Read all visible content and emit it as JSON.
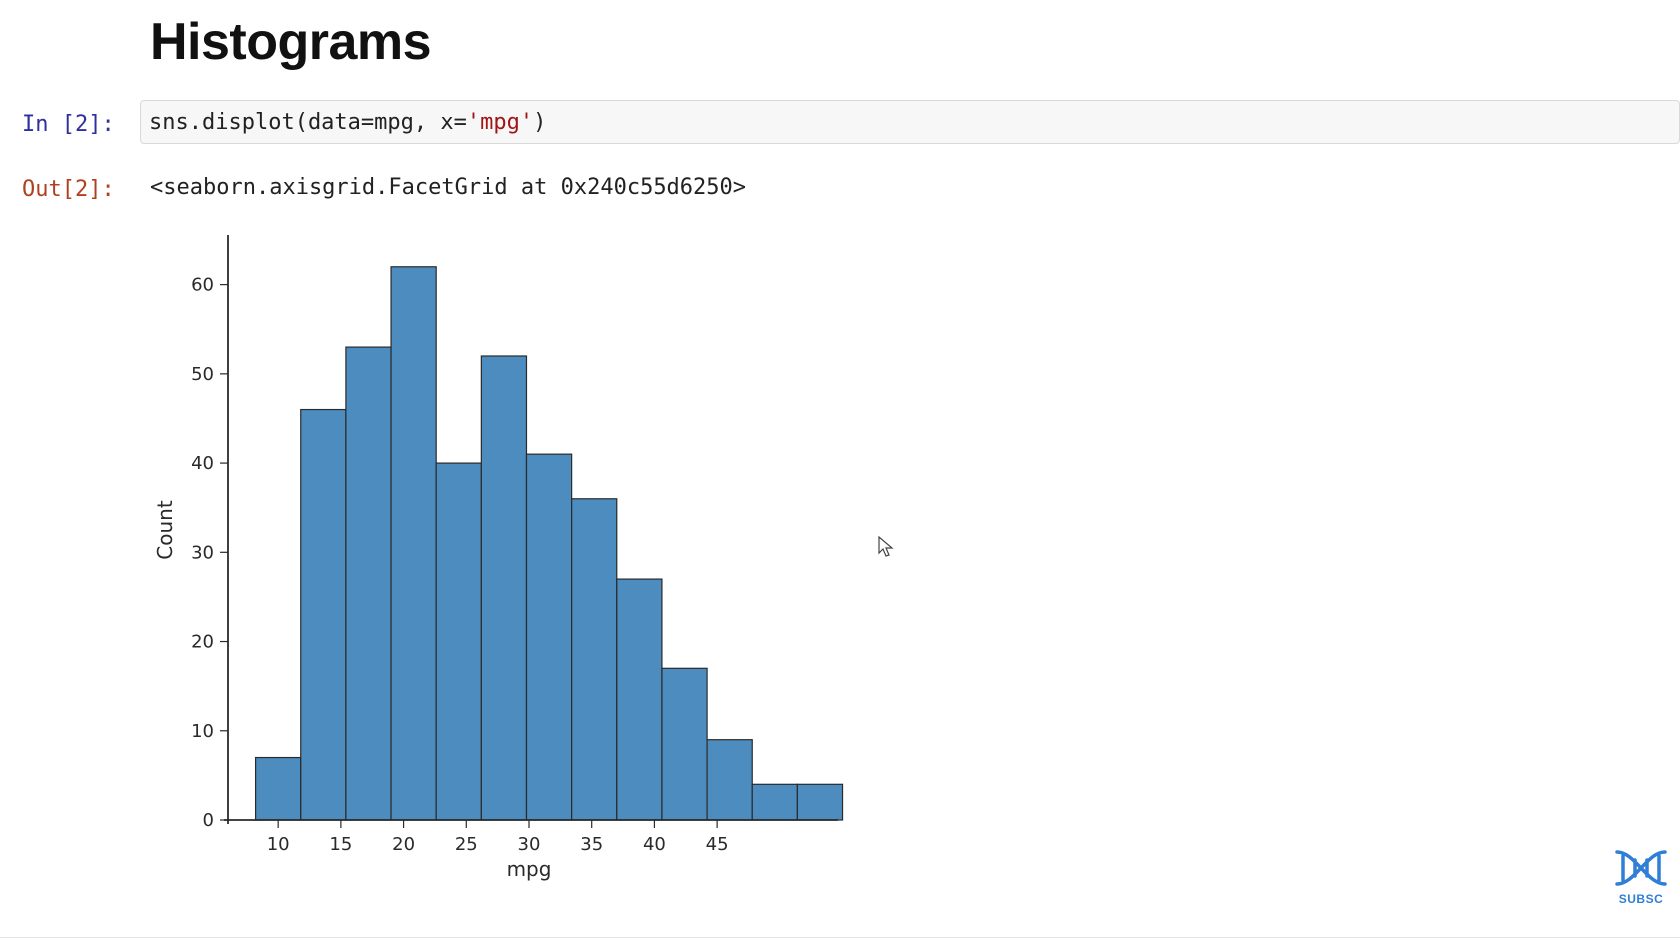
{
  "heading": "Histograms",
  "input_prompt": "In [2]:",
  "output_prompt": "Out[2]:",
  "code_tokens": {
    "p1": "sns.displot(data",
    "eq1": "=",
    "p2": "mpg, x",
    "eq2": "=",
    "str": "'mpg'",
    "p3": ")"
  },
  "output_text": "<seaborn.axisgrid.FacetGrid at 0x240c55d6250>",
  "subscribe": "SUBSC",
  "chart_data": {
    "type": "bar",
    "bin_starts": [
      8.2,
      11.8,
      15.4,
      19.0,
      22.6,
      26.2,
      29.8,
      33.4,
      37.0,
      40.6,
      44.2,
      47.8
    ],
    "values": [
      7,
      46,
      53,
      62,
      40,
      52,
      41,
      36,
      27,
      17,
      9,
      4,
      4
    ],
    "xlabel": "mpg",
    "ylabel": "Count",
    "xticks": [
      10,
      15,
      20,
      25,
      30,
      35,
      40,
      45
    ],
    "yticks": [
      0,
      10,
      20,
      30,
      40,
      50,
      60
    ],
    "xlim": [
      6,
      54
    ],
    "ylim": [
      0,
      65
    ],
    "bar_color": "#4c8cbf"
  }
}
